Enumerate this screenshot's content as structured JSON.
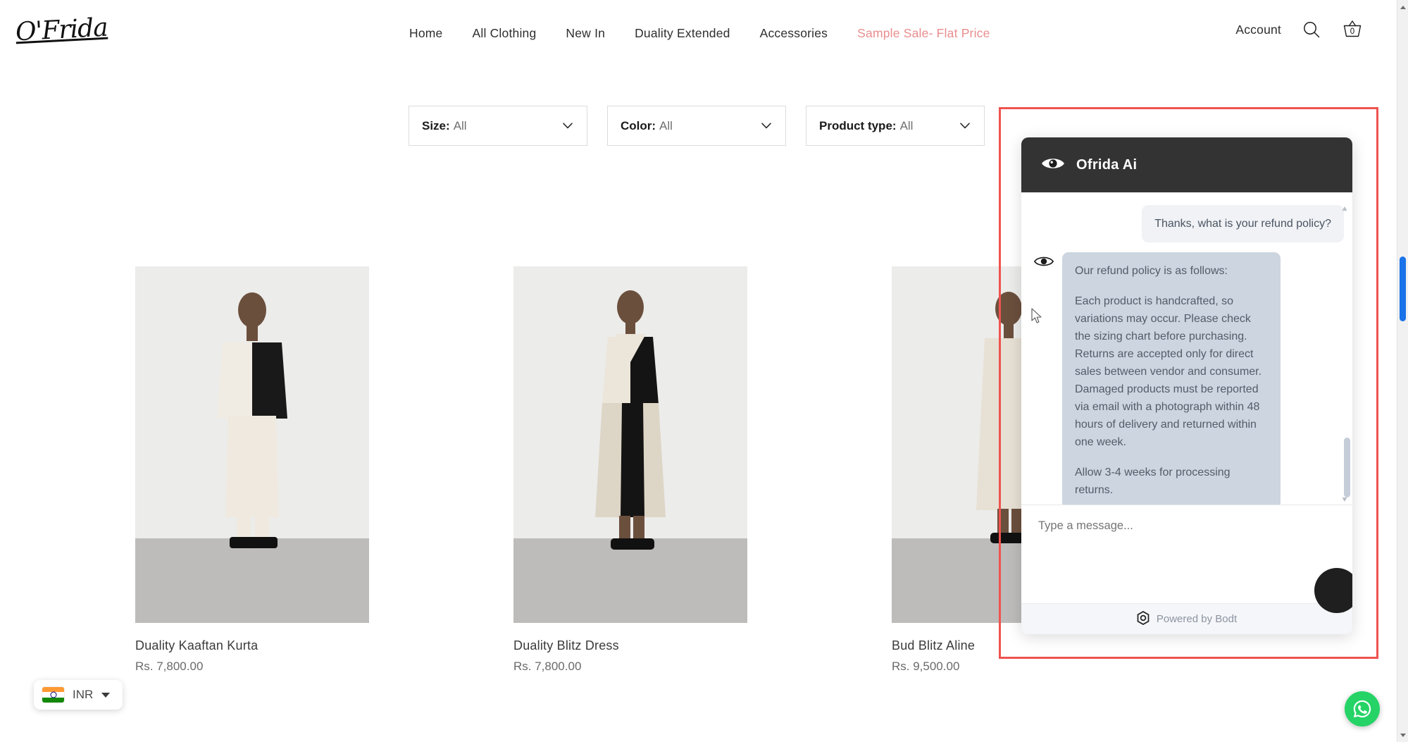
{
  "site": {
    "logo_text": "O'Frida"
  },
  "nav": {
    "items": [
      {
        "label": "Home",
        "highlight": false
      },
      {
        "label": "All Clothing",
        "highlight": false
      },
      {
        "label": "New In",
        "highlight": false
      },
      {
        "label": "Duality Extended",
        "highlight": false
      },
      {
        "label": "Accessories",
        "highlight": false
      },
      {
        "label": "Sample Sale- Flat Price",
        "highlight": true
      }
    ],
    "sale_color": "#e98d8d"
  },
  "header_right": {
    "account_label": "Account",
    "search_icon": "search-icon",
    "basket_icon": "basket-icon",
    "basket_count": "0"
  },
  "filters": [
    {
      "label": "Size:",
      "value": "All",
      "icon": "chevron-down-icon"
    },
    {
      "label": "Color:",
      "value": "All",
      "icon": "chevron-down-icon"
    },
    {
      "label": "Product type:",
      "value": "All",
      "icon": "chevron-down-icon"
    }
  ],
  "products": [
    {
      "name": "Duality Kaaftan Kurta",
      "price": "Rs. 7,800.00"
    },
    {
      "name": "Duality Blitz Dress",
      "price": "Rs. 7,800.00"
    },
    {
      "name": "Bud Blitz Aline",
      "price": "Rs. 9,500.00"
    }
  ],
  "currency": {
    "code": "INR",
    "flag": "india-flag-icon",
    "caret": "caret-down-icon"
  },
  "whatsapp": {
    "icon": "whatsapp-icon",
    "color": "#25D366"
  },
  "chat": {
    "header_title": "Ofrida Ai",
    "header_icon": "eye-icon",
    "bot_avatar_icon": "eye-icon",
    "messages": [
      {
        "role": "user",
        "text": "Thanks, what is your refund policy?"
      },
      {
        "role": "bot",
        "paragraphs": [
          "Our refund policy is as follows:",
          "Each product is handcrafted, so variations may occur. Please check the sizing chart before purchasing. Returns are accepted only for direct sales between vendor and consumer. Damaged products must be reported via email with a photograph within 48 hours of delivery and returned within one week.",
          "Allow 3-4 weeks for processing returns."
        ]
      }
    ],
    "input_placeholder": "Type a message...",
    "footer_text": "Powered by Bodt",
    "footer_icon": "bodt-hexagon-logo",
    "send_button_icon": "send-button"
  },
  "annotation": {
    "highlight_color": "#ef5350"
  },
  "scrollbar": {
    "thumb_color": "#1a73e8"
  }
}
